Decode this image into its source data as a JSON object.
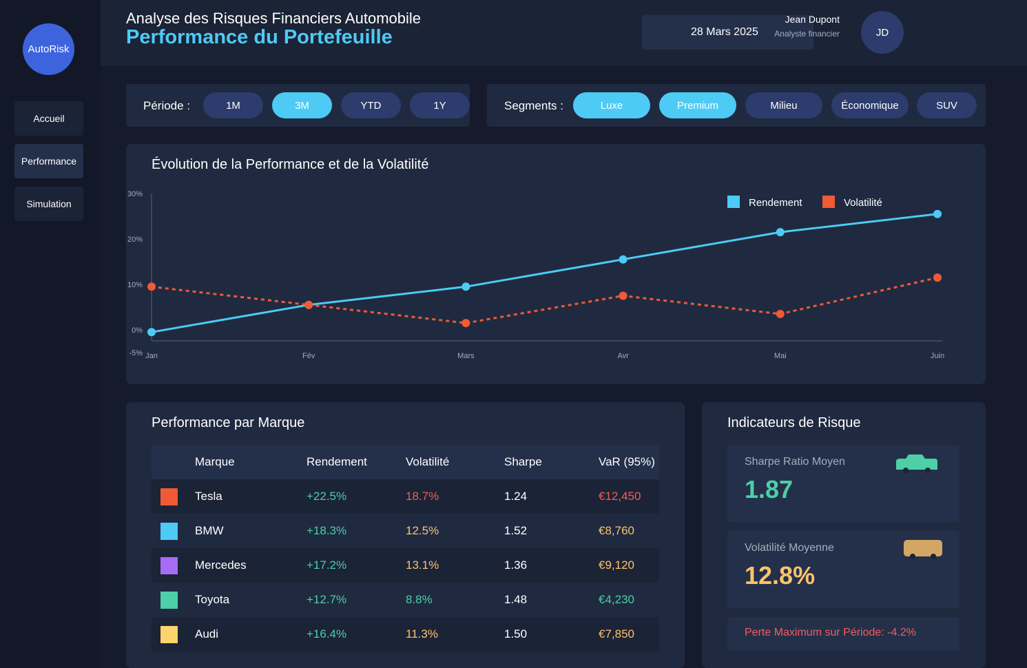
{
  "sidebar": {
    "logo": "AutoRisk",
    "items": [
      {
        "label": "Accueil"
      },
      {
        "label": "Performance"
      },
      {
        "label": "Simulation"
      }
    ]
  },
  "header": {
    "subtitle": "Analyse des Risques Financiers Automobile",
    "title": "Performance du Portefeuille",
    "date": "28 Mars 2025",
    "user_name": "Jean Dupont",
    "user_role": "Analyste financier",
    "avatar_initials": "JD"
  },
  "period_filter": {
    "label": "Période :",
    "options": [
      "1M",
      "3M",
      "YTD",
      "1Y"
    ],
    "selected": [
      "3M"
    ]
  },
  "segment_filter": {
    "label": "Segments :",
    "options": [
      "Luxe",
      "Premium",
      "Milieu",
      "Économique",
      "SUV"
    ],
    "selected": [
      "Luxe",
      "Premium"
    ]
  },
  "chart_panel": {
    "title": "Évolution de la Performance et de la Volatilité"
  },
  "chart_data": {
    "type": "line",
    "title": "Évolution de la Performance et de la Volatilité",
    "categories": [
      "Jan",
      "Fév",
      "Mars",
      "Avr",
      "Mai",
      "Juin"
    ],
    "series": [
      {
        "name": "Rendement",
        "color": "#4dcbf5",
        "style": "solid",
        "values": [
          -0.5,
          5.5,
          9.5,
          15.5,
          21.5,
          25.5
        ]
      },
      {
        "name": "Volatilité",
        "color": "#f05a35",
        "style": "dashed",
        "values": [
          9.5,
          5.5,
          1.5,
          7.5,
          3.5,
          11.5
        ]
      }
    ],
    "y_ticks": [
      "30%",
      "20%",
      "10%",
      "0%",
      "-5%"
    ],
    "y_tick_values": [
      30,
      20,
      10,
      0,
      -5
    ],
    "ylim": [
      -5,
      30
    ],
    "legend_position": "top-right",
    "grid": false
  },
  "brand_panel": {
    "title": "Performance par Marque",
    "columns": [
      "Marque",
      "Rendement",
      "Volatilité",
      "Sharpe",
      "VaR (95%)"
    ],
    "rows": [
      {
        "brand": "Tesla",
        "color": "#f05a35",
        "rendement": "+22.5%",
        "volatilite": "18.7%",
        "vol_color": "#f25d5d",
        "sharpe": "1.24",
        "var": "€12,450",
        "var_color": "#f25d5d"
      },
      {
        "brand": "BMW",
        "color": "#4dcbf5",
        "rendement": "+18.3%",
        "volatilite": "12.5%",
        "vol_color": "#fdc36b",
        "sharpe": "1.52",
        "var": "€8,760",
        "var_color": "#fdc36b"
      },
      {
        "brand": "Mercedes",
        "color": "#a66cf5",
        "rendement": "+17.2%",
        "volatilite": "13.1%",
        "vol_color": "#fdc36b",
        "sharpe": "1.36",
        "var": "€9,120",
        "var_color": "#fdc36b"
      },
      {
        "brand": "Toyota",
        "color": "#4dcfa8",
        "rendement": "+12.7%",
        "volatilite": "8.8%",
        "vol_color": "#4dcfa8",
        "sharpe": "1.48",
        "var": "€4,230",
        "var_color": "#4dcfa8"
      },
      {
        "brand": "Audi",
        "color": "#fdd46b",
        "rendement": "+16.4%",
        "volatilite": "11.3%",
        "vol_color": "#fdc36b",
        "sharpe": "1.50",
        "var": "€7,850",
        "var_color": "#fdc36b"
      }
    ],
    "rendement_color": "#4dcfa8"
  },
  "risk_panel": {
    "title": "Indicateurs de Risque",
    "sharpe": {
      "label": "Sharpe Ratio Moyen",
      "value": "1.87",
      "color": "#4dcfa8",
      "icon": "car-icon"
    },
    "volatility": {
      "label": "Volatilité Moyenne",
      "value": "12.8%",
      "color": "#fdc36b",
      "icon": "van-icon"
    },
    "max_loss": {
      "text": "Perte Maximum sur Période: -4.2%",
      "color": "#f25d5d"
    }
  }
}
